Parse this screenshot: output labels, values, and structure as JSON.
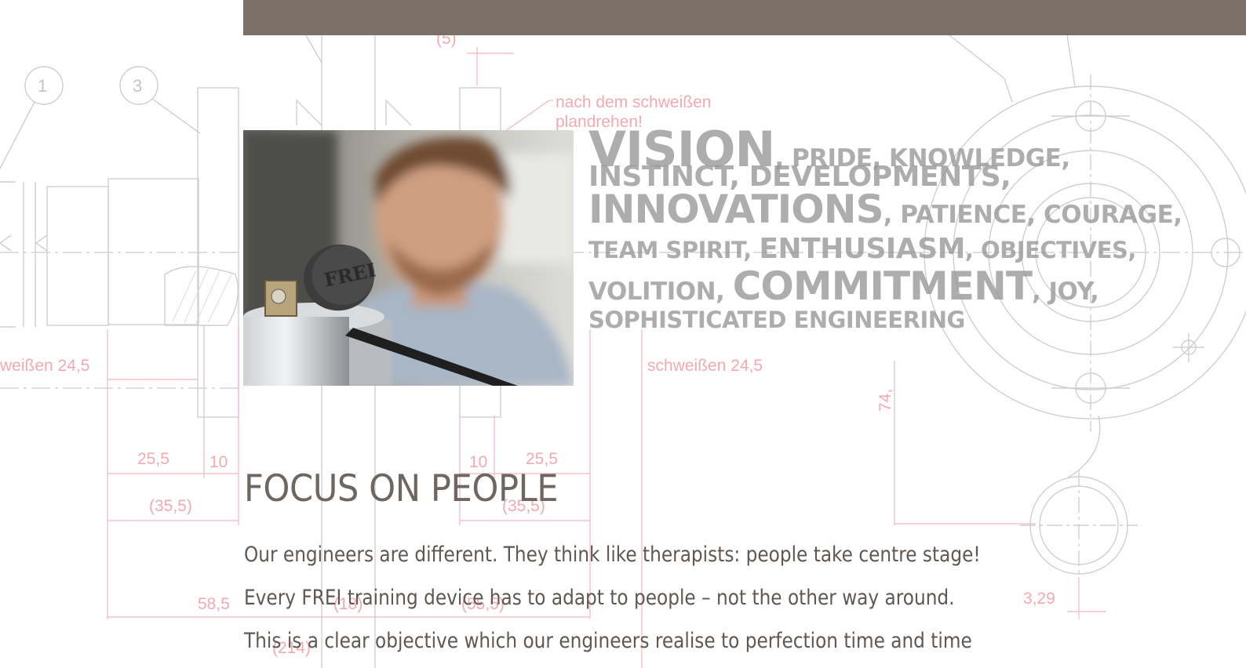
{
  "colors": {
    "top_bar": "#7a7067",
    "heading": "#6e6761",
    "body_text": "#5f5852",
    "word_cloud": "#969696",
    "drawing_lines": "#c8c8c8",
    "drawing_dimensions": "#f2aab0"
  },
  "drawing": {
    "balloons": [
      "1",
      "3"
    ],
    "note_line1": "nach dem schweißen",
    "note_line2": "plandrehen!",
    "weld_left": "weißen 24,5",
    "weld_center": "schweißen 24,5",
    "dims": {
      "top_paren": "(5)",
      "left_25": "25,5",
      "left_10": "10",
      "left_35": "(35,5)",
      "right_10": "10",
      "right_25": "25,5",
      "right_35": "(35,5)",
      "d_58": "58,5",
      "d_18": "(18)",
      "d_55": "(55,5)",
      "d_214": "(214)",
      "d_74": "74,",
      "d_329": "3,29"
    }
  },
  "photo": {
    "label": "FREI"
  },
  "word_cloud": {
    "line1": [
      "VISION",
      ", PRIDE, KNOWLEDGE,"
    ],
    "line2": "INSTINCT, DEVELOPMENTS,",
    "line3": [
      "INNOVATIONS",
      ", PATIENCE, COURAGE,"
    ],
    "line4": [
      "TEAM SPIRIT, ",
      "ENTHUSIASM",
      ", OBJECTIVES,"
    ],
    "line5": [
      "VOLITION, ",
      "COMMITMENT",
      ", JOY,"
    ],
    "line6": "SOPHISTICATED ENGINEERING"
  },
  "section": {
    "title": "FOCUS ON PEOPLE",
    "paragraphs": [
      "Our engineers are different. They think like therapists: people take centre stage!",
      "Every FREI training device has to adapt to people – not the other way around.",
      "This is a clear objective which our engineers realise to perfection time and time"
    ]
  }
}
